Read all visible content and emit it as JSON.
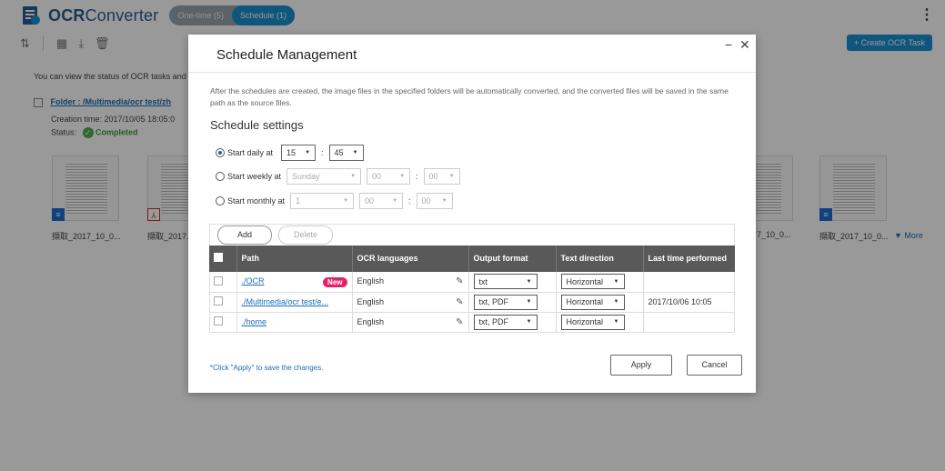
{
  "app": {
    "title_bold": "OCR",
    "title_rest": "Converter",
    "tabs": [
      {
        "label": "One-time (5)"
      },
      {
        "label": "Schedule (1)"
      }
    ],
    "menu_icon": "kebab-menu-icon",
    "create_button": "+ Create OCR Task",
    "info_text": "You can view the status of OCR tasks and",
    "task": {
      "folder_link": "Folder : /Multimedia/ocr test/zh",
      "creation_time": "Creation time: 2017/10/05 18:05:0",
      "status_label": "Status:",
      "status_value": "Completed"
    },
    "thumbnails": [
      {
        "label": "擷取_2017_10_0..."
      },
      {
        "label": "擷取_2017..."
      },
      {
        "label": "7_10_0..."
      },
      {
        "label": "擷取_2017_10_0..."
      }
    ],
    "more_link": "▼ More"
  },
  "modal": {
    "title": "Schedule Management",
    "description": "After the schedules are created, the image files in the specified folders will be automatically converted, and the converted files will be saved in the same path as the source files.",
    "section_title": "Schedule settings",
    "daily": {
      "label": "Start daily at",
      "hour": "15",
      "minute": "45"
    },
    "weekly": {
      "label": "Start weekly at",
      "day": "Sunday",
      "hour": "00",
      "minute": "00"
    },
    "monthly": {
      "label": "Start monthly at",
      "day": "1",
      "hour": "00",
      "minute": "00"
    },
    "add_button": "Add",
    "delete_button": "Delete",
    "columns": {
      "path": "Path",
      "languages": "OCR languages",
      "format": "Output format",
      "direction": "Text direction",
      "last_time": "Last time performed"
    },
    "rows": [
      {
        "path": "./OCR",
        "badge": "New",
        "language": "English",
        "format": "txt",
        "direction": "Horizontal",
        "last": ""
      },
      {
        "path": "./Multimedia/ocr test/e...",
        "badge": "",
        "language": "English",
        "format": "txt, PDF",
        "direction": "Horizontal",
        "last": "2017/10/06 10:05"
      },
      {
        "path": "./home",
        "badge": "",
        "language": "English",
        "format": "txt, PDF",
        "direction": "Horizontal",
        "last": ""
      }
    ],
    "hint": "*Click \"Apply\" to save the changes.",
    "apply_button": "Apply",
    "cancel_button": "Cancel"
  }
}
